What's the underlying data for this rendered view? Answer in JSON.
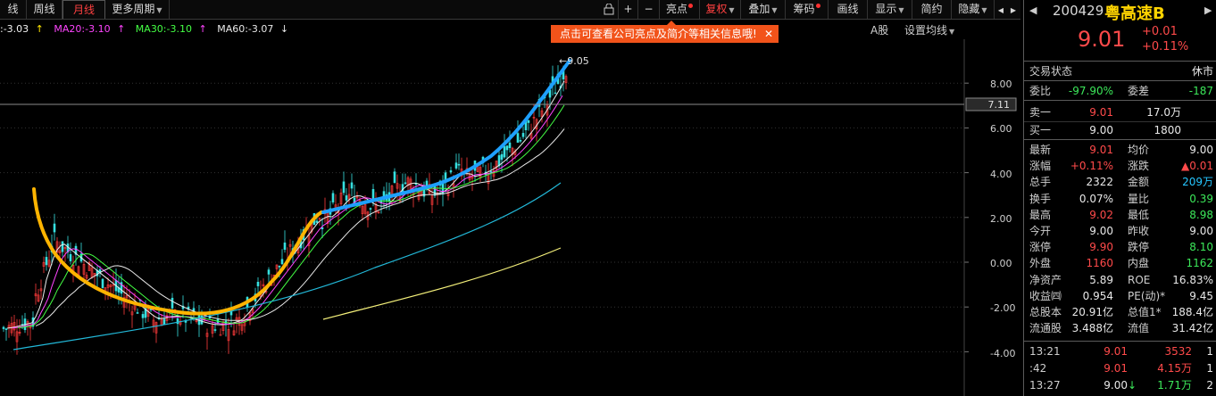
{
  "toolbar": {
    "tabs": [
      {
        "label": "线"
      },
      {
        "label": "周线"
      },
      {
        "label": "月线"
      },
      {
        "label": "更多周期"
      }
    ],
    "right_buttons": [
      {
        "label": "亮点"
      },
      {
        "label": "复权"
      },
      {
        "label": "叠加"
      },
      {
        "label": "筹码"
      },
      {
        "label": "画线"
      },
      {
        "label": "显示"
      },
      {
        "label": "简约"
      },
      {
        "label": "隐藏"
      }
    ],
    "icons": {
      "lock": "lock-icon",
      "plus": "+",
      "minus": "−",
      "prev": "◀",
      "next": "▶"
    }
  },
  "ma": {
    "ma10": ":-3.03",
    "ma20": "MA20:-3.10",
    "ma30": "MA30:-3.10",
    "ma60": "MA60:-3.07",
    "arrow_up": "↑",
    "arrow_down": "↓"
  },
  "chart_header": {
    "market": "A股",
    "settings": "设置均线"
  },
  "tooltip": {
    "text": "点击可查看公司亮点及简介等相关信息哦!",
    "close": "✕"
  },
  "chart": {
    "price_label": "←9.05",
    "current_price": "7.11",
    "y_ticks": [
      "8.00",
      "6.00",
      "4.00",
      "2.00",
      "0.00",
      "-2.00",
      "-4.00"
    ]
  },
  "chart_data": {
    "type": "line",
    "y_ticks": [
      8.0,
      6.0,
      4.0,
      2.0,
      0.0,
      -2.0,
      -4.0
    ],
    "reference_line": 7.11,
    "max_marker": 9.05,
    "annotations": [
      "yellow hand-drawn rounded-bottom curve",
      "blue hand-drawn rising curve"
    ]
  },
  "quote": {
    "code": "200429",
    "name": "粤高速B",
    "price": "9.01",
    "change": "+0.01",
    "change_pct": "+0.11%",
    "status_label": "交易状态",
    "status_value": "休市",
    "weibi_label": "委比",
    "weibi": "-97.90%",
    "weicha_label": "委差",
    "weicha": "-187",
    "sell1_label": "卖一",
    "sell1_price": "9.01",
    "sell1_vol": "17.0万",
    "buy1_label": "买一",
    "buy1_price": "9.00",
    "buy1_vol": "1800",
    "stats": [
      {
        "l1": "最新",
        "v1": "9.01",
        "c1": "red",
        "l2": "均价",
        "v2": "9.00",
        "c2": "white"
      },
      {
        "l1": "涨幅",
        "v1": "+0.11%",
        "c1": "red",
        "l2": "涨跌",
        "v2": "▲0.01",
        "c2": "red"
      },
      {
        "l1": "总手",
        "v1": "2322",
        "c1": "white",
        "l2": "金额",
        "v2": "209万",
        "c2": "cyan"
      },
      {
        "l1": "换手",
        "v1": "0.07%",
        "c1": "white",
        "l2": "量比",
        "v2": "0.39",
        "c2": "green"
      },
      {
        "l1": "最高",
        "v1": "9.02",
        "c1": "red",
        "l2": "最低",
        "v2": "8.98",
        "c2": "green"
      },
      {
        "l1": "今开",
        "v1": "9.00",
        "c1": "white",
        "l2": "昨收",
        "v2": "9.00",
        "c2": "white"
      },
      {
        "l1": "涨停",
        "v1": "9.90",
        "c1": "red",
        "l2": "跌停",
        "v2": "8.10",
        "c2": "green"
      },
      {
        "l1": "外盘",
        "v1": "1160",
        "c1": "red",
        "l2": "内盘",
        "v2": "1162",
        "c2": "green"
      },
      {
        "l1": "净资产",
        "v1": "5.89",
        "c1": "white",
        "l2": "ROE",
        "v2": "16.83%",
        "c2": "white"
      },
      {
        "l1": "收益㈣",
        "v1": "0.954",
        "c1": "white",
        "l2": "PE(动)*",
        "v2": "9.45",
        "c2": "white"
      },
      {
        "l1": "总股本",
        "v1": "20.91亿",
        "c1": "white",
        "l2": "总值1*",
        "v2": "188.4亿",
        "c2": "white"
      },
      {
        "l1": "流通股",
        "v1": "3.488亿",
        "c1": "white",
        "l2": "流值",
        "v2": "31.42亿",
        "c2": "white"
      }
    ],
    "trades": [
      {
        "time": "13:21",
        "price": "9.01",
        "pc": "red",
        "arrow": "",
        "vol": "3532",
        "vc": "red",
        "n": "1"
      },
      {
        "time": ":42",
        "price": "9.01",
        "pc": "red",
        "arrow": "",
        "vol": "4.15万",
        "vc": "red",
        "n": "1"
      },
      {
        "time": "13:27",
        "price": "9.00",
        "pc": "white",
        "arrow": "↓",
        "vol": "1.71万",
        "vc": "green",
        "n": "2"
      }
    ]
  }
}
